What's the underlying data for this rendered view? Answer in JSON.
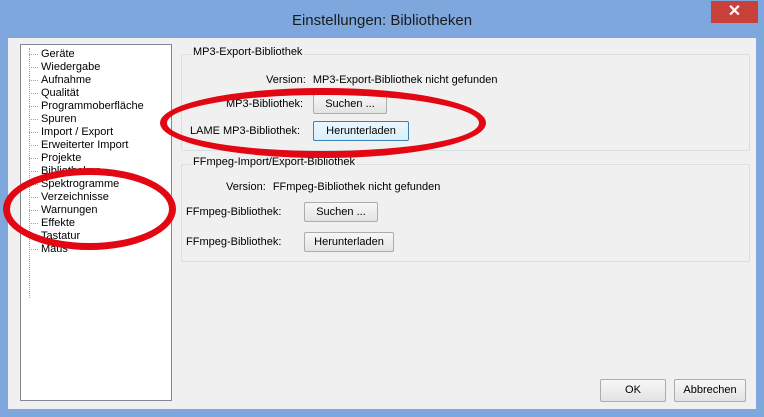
{
  "window": {
    "title": "Einstellungen: Bibliotheken",
    "close_label": "✕"
  },
  "sidebar": {
    "items": [
      "Geräte",
      "Wiedergabe",
      "Aufnahme",
      "Qualität",
      "Programmoberfläche",
      "Spuren",
      "Import / Export",
      "Erweiterter Import",
      "Projekte",
      "Bibliotheken",
      "Spektrogramme",
      "Verzeichnisse",
      "Warnungen",
      "Effekte",
      "Tastatur",
      "Maus"
    ],
    "selected_index": 9
  },
  "mp3": {
    "group_title": "MP3-Export-Bibliothek",
    "version_label": "Version:",
    "version_value": "MP3-Export-Bibliothek nicht gefunden",
    "lib_label": "MP3-Bibliothek:",
    "search_button": "Suchen ...",
    "lame_label": "LAME MP3-Bibliothek:",
    "download_button": "Herunterladen"
  },
  "ffmpeg": {
    "group_title": "FFmpeg-Import/Export-Bibliothek",
    "version_label": "Version:",
    "version_value": "FFmpeg-Bibliothek nicht gefunden",
    "lib_label": "FFmpeg-Bibliothek:",
    "search_button": "Suchen ...",
    "lib_label2": "FFmpeg-Bibliothek:",
    "download_button": "Herunterladen"
  },
  "footer": {
    "ok": "OK",
    "cancel": "Abbrechen"
  },
  "annotation_color": "#e30613"
}
